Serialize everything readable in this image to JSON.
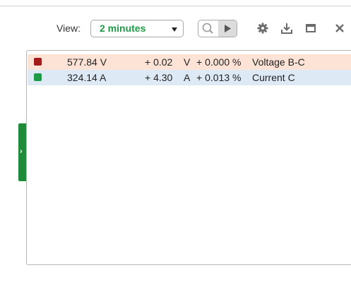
{
  "toolbar": {
    "view_label": "View:",
    "view_selected": "2 minutes",
    "icons": {
      "zoom": "zoom-icon",
      "play": "play-icon",
      "settings": "gear-icon",
      "download": "download-icon",
      "maximize": "maximize-icon",
      "close": "close-icon"
    }
  },
  "side_tab": {
    "chevron": "›"
  },
  "rows": [
    {
      "color": "#a31a1a",
      "background": "#fde3d6",
      "value": "577.84 V",
      "delta": "+ 0.02",
      "unit": "V",
      "percent": "+ 0.000 %",
      "name": "Voltage B-C"
    },
    {
      "color": "#1e9a47",
      "background": "#dde9f5",
      "value": "324.14 A",
      "delta": "+ 4.30",
      "unit": "A",
      "percent": "+ 0.013 %",
      "name": "Current C"
    }
  ]
}
